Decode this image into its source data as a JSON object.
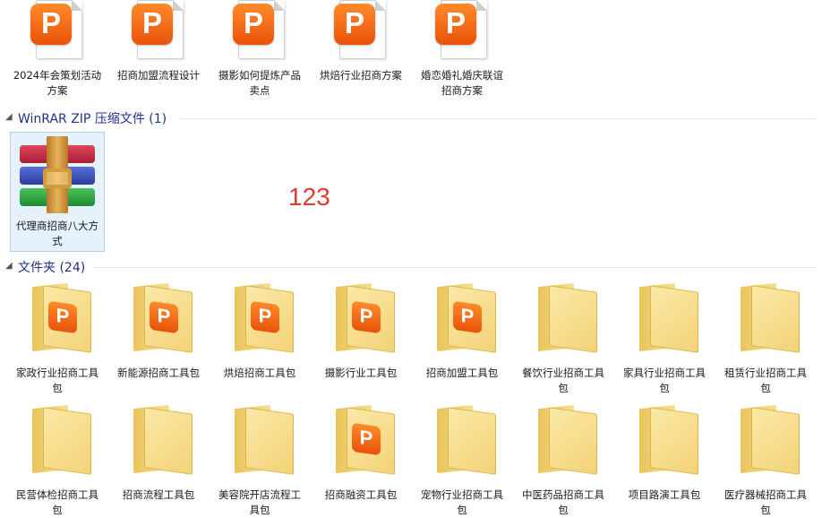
{
  "top_files": [
    {
      "label": "2024年会策划活动方案"
    },
    {
      "label": "招商加盟流程设计"
    },
    {
      "label": "摄影如何提炼产品卖点"
    },
    {
      "label": "烘焙行业招商方案"
    },
    {
      "label": "婚恋婚礼婚庆联谊招商方案"
    }
  ],
  "groups": {
    "winrar": {
      "title": "WinRAR ZIP 压缩文件 (1)"
    },
    "folders": {
      "title": "文件夹 (24)"
    }
  },
  "zip_file": {
    "label": "代理商招商八大方式"
  },
  "annotation": "123",
  "folder_row1": [
    {
      "label": "家政行业招商工具包",
      "icon": "ppt"
    },
    {
      "label": "新能源招商工具包",
      "icon": "ppt"
    },
    {
      "label": "烘焙招商工具包",
      "icon": "ppt"
    },
    {
      "label": "摄影行业工具包",
      "icon": "docs"
    },
    {
      "label": "招商加盟工具包",
      "icon": "ppt"
    },
    {
      "label": "餐饮行业招商工具包",
      "icon": "docs"
    },
    {
      "label": "家具行业招商工具包",
      "icon": "docs"
    },
    {
      "label": "租赁行业招商工具包",
      "icon": "docs"
    }
  ],
  "folder_row2": [
    {
      "label": "民营体检招商工具包",
      "icon": "image"
    },
    {
      "label": "招商流程工具包",
      "icon": "docs"
    },
    {
      "label": "美容院开店流程工具包",
      "icon": "docs"
    },
    {
      "label": "招商融资工具包",
      "icon": "ppt"
    },
    {
      "label": "宠物行业招商工具包",
      "icon": "docs"
    },
    {
      "label": "中医药品招商工具包",
      "icon": "docs"
    },
    {
      "label": "项目路演工具包",
      "icon": "docs"
    },
    {
      "label": "医疗器械招商工具包",
      "icon": "docs"
    }
  ],
  "colors": {
    "ppt_orange": "#e8530a",
    "group_title": "#1e3287",
    "annotation_red": "#e03b30"
  }
}
